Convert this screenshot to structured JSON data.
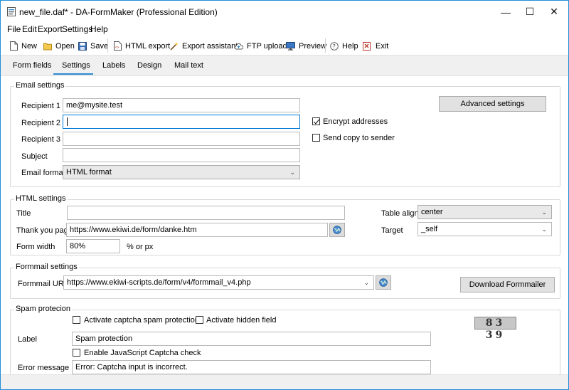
{
  "window": {
    "title": "new_file.daf* - DA-FormMaker (Professional Edition)",
    "controls": {
      "minimize": "—",
      "maximize": "☐",
      "close": "✕"
    }
  },
  "menu": [
    "File",
    "Edit",
    "Export",
    "Settings",
    "Help"
  ],
  "toolbar": {
    "new": "New",
    "open": "Open",
    "save": "Save",
    "html_export": "HTML export",
    "export_assistant": "Export assistant",
    "ftp_upload": "FTP upload",
    "preview": "Preview",
    "help": "Help",
    "exit": "Exit"
  },
  "tabs": [
    "Form fields",
    "Settings",
    "Labels",
    "Design",
    "Mail text"
  ],
  "active_tab": "Settings",
  "email_settings": {
    "title": "Email settings",
    "recipient1_label": "Recipient 1",
    "recipient1_value": "me@mysite.test",
    "recipient2_label": "Recipient 2",
    "recipient2_value": "",
    "recipient3_label": "Recipient 3",
    "recipient3_value": "",
    "subject_label": "Subject",
    "subject_value": "",
    "format_label": "Email format",
    "format_value": "HTML format",
    "encrypt_label": "Encrypt addresses",
    "encrypt_checked": true,
    "copy_label": "Send copy to sender",
    "copy_checked": false,
    "advanced_button": "Advanced settings"
  },
  "html_settings": {
    "title": "HTML settings",
    "title_label": "Title",
    "title_value": "",
    "thankyou_label": "Thank you page",
    "thankyou_value": "https://www.ekiwi.de/form/danke.htm",
    "width_label": "Form width",
    "width_value": "80%",
    "width_unit": "% or px",
    "align_label": "Table align",
    "align_value": "center",
    "target_label": "Target",
    "target_value": "_self"
  },
  "formmail_settings": {
    "title": "Formmail settings",
    "url_label": "Formmail URL",
    "url_value": "https://www.ekiwi-scripts.de/form/v4/formmail_v4.php",
    "download_button": "Download Formmailer"
  },
  "spam_protection": {
    "title": "Spam protecion",
    "captcha_label": "Activate captcha spam protection",
    "captcha_checked": false,
    "hidden_label": "Activate hidden field",
    "hidden_checked": false,
    "label_label": "Label",
    "label_value": "Spam protection",
    "js_label": "Enable JavaScript Captcha check",
    "js_checked": false,
    "error_label": "Error message",
    "error_value": "Error: Captcha input is incorrect.",
    "captcha_image_text": "83 39"
  },
  "colors": {
    "window_border": "#1f8fd8",
    "tab_underline": "#2a8ad4",
    "focus_border": "#0078d7"
  }
}
